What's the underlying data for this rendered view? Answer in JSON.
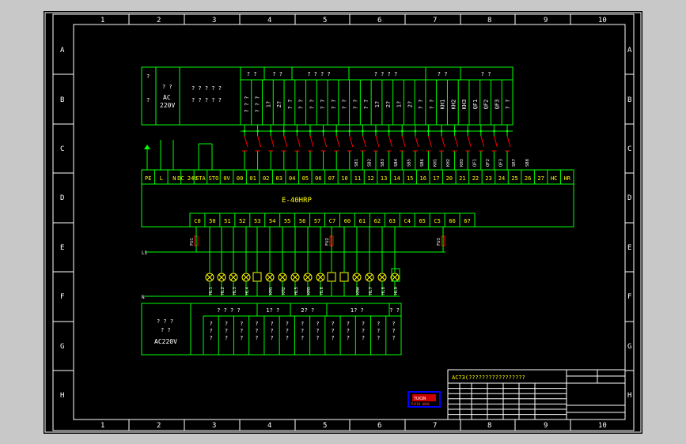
{
  "frame": {
    "col_labels": [
      "1",
      "2",
      "3",
      "4",
      "5",
      "6",
      "7",
      "8",
      "9",
      "10"
    ],
    "row_labels": [
      "A",
      "B",
      "C",
      "D",
      "E",
      "F",
      "G",
      "H"
    ]
  },
  "top_table": {
    "power_cell": {
      "q1": "?",
      "q2": "?",
      "line1": "? ?",
      "line2": "AC",
      "line3": "220V"
    },
    "desc_cell": {
      "line1": "? ? ? ? ?",
      "line2": "? ? ? ? ?"
    },
    "group_headers": [
      "? ?",
      "? ?",
      "? ? ? ?",
      "? ? ? ?",
      "? ?",
      "? ?"
    ],
    "column_texts": [
      "? ? ?",
      "? ? ?",
      "1?",
      "2?",
      "? ?",
      "? ?",
      "? ?",
      "? ?",
      "? ?",
      "? ?",
      "? ?",
      "? ?",
      "1?",
      "2?",
      "1?",
      "2?",
      "? ?",
      "? ?",
      "KH1",
      "KH2",
      "KH3",
      "QF1",
      "QF2",
      "QF3",
      "? ?"
    ]
  },
  "plc": {
    "model": "E-40HRP",
    "top_terminals": [
      "PE",
      "L",
      "N",
      "DC 24V",
      "STA",
      "STO",
      "0V",
      "00",
      "01",
      "02",
      "03",
      "04",
      "05",
      "06",
      "07",
      "10",
      "11",
      "12",
      "13",
      "14",
      "15",
      "16",
      "17",
      "20",
      "21",
      "22",
      "23",
      "24",
      "25",
      "26",
      "27",
      "HC",
      "HR"
    ],
    "bottom_terminals": [
      "C0",
      "50",
      "51",
      "52",
      "53",
      "54",
      "55",
      "56",
      "57",
      "C7",
      "60",
      "61",
      "62",
      "63",
      "C4",
      "65",
      "C5",
      "66",
      "67"
    ]
  },
  "input_devices": [
    "SB1",
    "SB2",
    "SB3",
    "SB4",
    "SB5",
    "SB6",
    "KH1",
    "KH2",
    "KH3",
    "QF1",
    "QF2",
    "QF3",
    "SR7",
    "SB8"
  ],
  "fuses": [
    "FU1",
    "FU2",
    "FU3"
  ],
  "rail_labels": {
    "l": "L1",
    "n": "N"
  },
  "output_devices": [
    "HL1",
    "HL2",
    "HL3",
    "HL4",
    "KM1",
    "KM2",
    "HL5",
    "KM3",
    "HL6",
    "KM4",
    "HL7",
    "HL8",
    "HL9",
    "HL10"
  ],
  "bottom_table": {
    "power_cell": {
      "line1": "? ? ?",
      "line2": "? ?",
      "line3": "AC220V"
    },
    "group_headers": [
      "? ? ? ?",
      "1? ?",
      "2? ?",
      "1? ?",
      "? ?"
    ],
    "column_texts": [
      "? ? ?",
      "? ? ?",
      "? ? ?",
      "? ? ?",
      "? ? ?",
      "? ? ?",
      "? ? ?",
      "? ? ?",
      "? ? ?",
      "? ? ?",
      "? ? ?",
      "? ? ?",
      "? ? ?"
    ]
  },
  "title_block": {
    "title": "AC73(?????????????????"
  },
  "stamp": {
    "line1": "TUXIN",
    "line2": "TUXIN WANG"
  },
  "colors": {
    "background": "#000000",
    "frame": "#ffffff",
    "table": "#00ff00",
    "terminal": "#ffff00",
    "contact": "#ff0000",
    "text": "#ffffff",
    "stamp": "#0000ff"
  }
}
